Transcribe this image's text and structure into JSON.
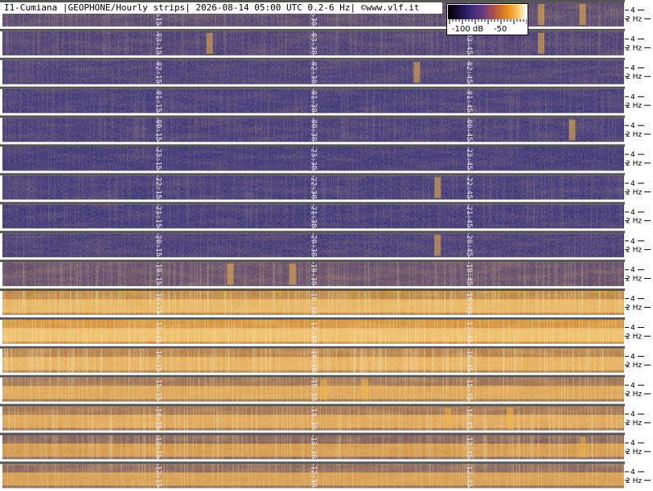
{
  "title": "I1-Cumiana |GEOPHONE/Hourly strips| 2026-08-14 05:00 UTC 0.2-6 Hz| ©www.vlf.it",
  "colorbar": {
    "min_label": "-100 dB",
    "max_label": "-50",
    "colors": [
      "#000000",
      "#1b1044",
      "#3a2a7a",
      "#6b3a7e",
      "#b5573f",
      "#e58a1c",
      "#f8c45a",
      "#ffffff"
    ]
  },
  "colors": {
    "background": "#ffffff",
    "strip_separator": "#555555",
    "marker_line": "#ffffff",
    "quiet": "#2c2670",
    "active": "#e89a2a"
  },
  "chart_data": {
    "type": "heatmap",
    "x_unit": "minutes within hour",
    "xlim": [
      0,
      60
    ],
    "y_axis_labels": [
      "4",
      "2 Hz"
    ],
    "markers_minutes": [
      15,
      30,
      45
    ],
    "strips": [
      {
        "labels": [
          "04:15",
          "04:30",
          "04:45"
        ],
        "activity": 0.18,
        "burst_minutes": [
          52,
          56
        ]
      },
      {
        "labels": [
          "03:15",
          "03:30",
          "03:45"
        ],
        "activity": 0.1,
        "burst_minutes": [
          20,
          52
        ]
      },
      {
        "labels": [
          "02:15",
          "02:30",
          "02:45"
        ],
        "activity": 0.08,
        "burst_minutes": [
          40
        ]
      },
      {
        "labels": [
          "01:15",
          "01:30",
          "01:45"
        ],
        "activity": 0.05,
        "burst_minutes": []
      },
      {
        "labels": [
          "00:15",
          "00:30",
          "00:45"
        ],
        "activity": 0.06,
        "burst_minutes": [
          55
        ]
      },
      {
        "labels": [
          "23:15",
          "23:30",
          "23:45"
        ],
        "activity": 0.04,
        "burst_minutes": []
      },
      {
        "labels": [
          "22:15",
          "22:30",
          "22:45"
        ],
        "activity": 0.05,
        "burst_minutes": [
          42
        ]
      },
      {
        "labels": [
          "21:15",
          "21:30",
          "21:45"
        ],
        "activity": 0.04,
        "burst_minutes": []
      },
      {
        "labels": [
          "20:15",
          "20:30",
          "20:45"
        ],
        "activity": 0.06,
        "burst_minutes": [
          42
        ]
      },
      {
        "labels": [
          "19:15",
          "19:30",
          "19:45"
        ],
        "activity": 0.25,
        "burst_minutes": [
          22,
          28
        ]
      },
      {
        "labels": [
          "18:15",
          "18:30",
          "18:45"
        ],
        "activity": 0.8,
        "burst_minutes": []
      },
      {
        "labels": [
          "17:15",
          "17:30",
          "17:45"
        ],
        "activity": 0.92,
        "burst_minutes": []
      },
      {
        "labels": [
          "16:15",
          "16:30",
          "16:45"
        ],
        "activity": 0.75,
        "burst_minutes": []
      },
      {
        "labels": [
          "15:15",
          "15:30",
          "15:45"
        ],
        "activity": 0.6,
        "burst_minutes": [
          31,
          35
        ]
      },
      {
        "labels": [
          "14:15",
          "14:30",
          "14:45"
        ],
        "activity": 0.62,
        "burst_minutes": [
          43,
          49
        ]
      },
      {
        "labels": [
          "13:15",
          "13:30",
          "13:45"
        ],
        "activity": 0.45,
        "burst_minutes": [
          56
        ]
      },
      {
        "labels": [
          "12:15",
          "12:30",
          "12:45"
        ],
        "activity": 0.5,
        "burst_minutes": []
      }
    ]
  }
}
